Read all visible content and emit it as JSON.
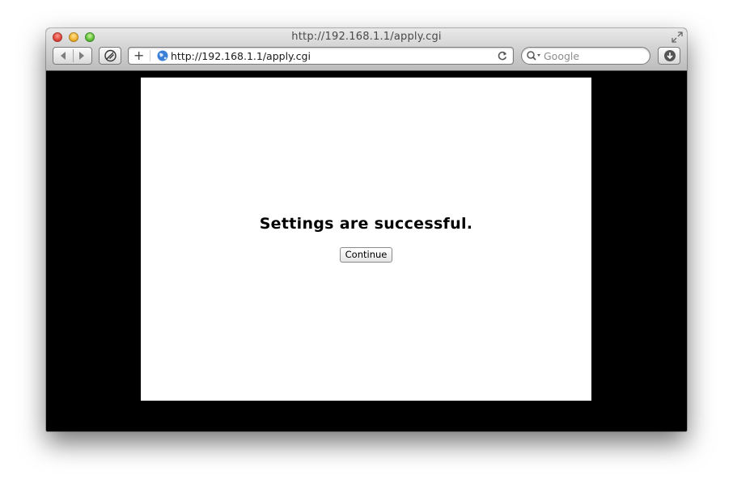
{
  "window": {
    "title": "http://192.168.1.1/apply.cgi"
  },
  "toolbar": {
    "address_value": "http://192.168.1.1/apply.cgi",
    "add_symbol": "+",
    "search_placeholder": "Google"
  },
  "page": {
    "message": "Settings are successful.",
    "continue_label": "Continue"
  },
  "colors": {
    "page_background": "#000000",
    "content_background": "#ffffff"
  },
  "icons": [
    "close-icon",
    "minimize-icon",
    "zoom-icon",
    "fullscreen-icon",
    "back-icon",
    "forward-icon",
    "reader-icon",
    "add-icon",
    "globe-icon",
    "reload-icon",
    "search-icon",
    "download-icon"
  ]
}
